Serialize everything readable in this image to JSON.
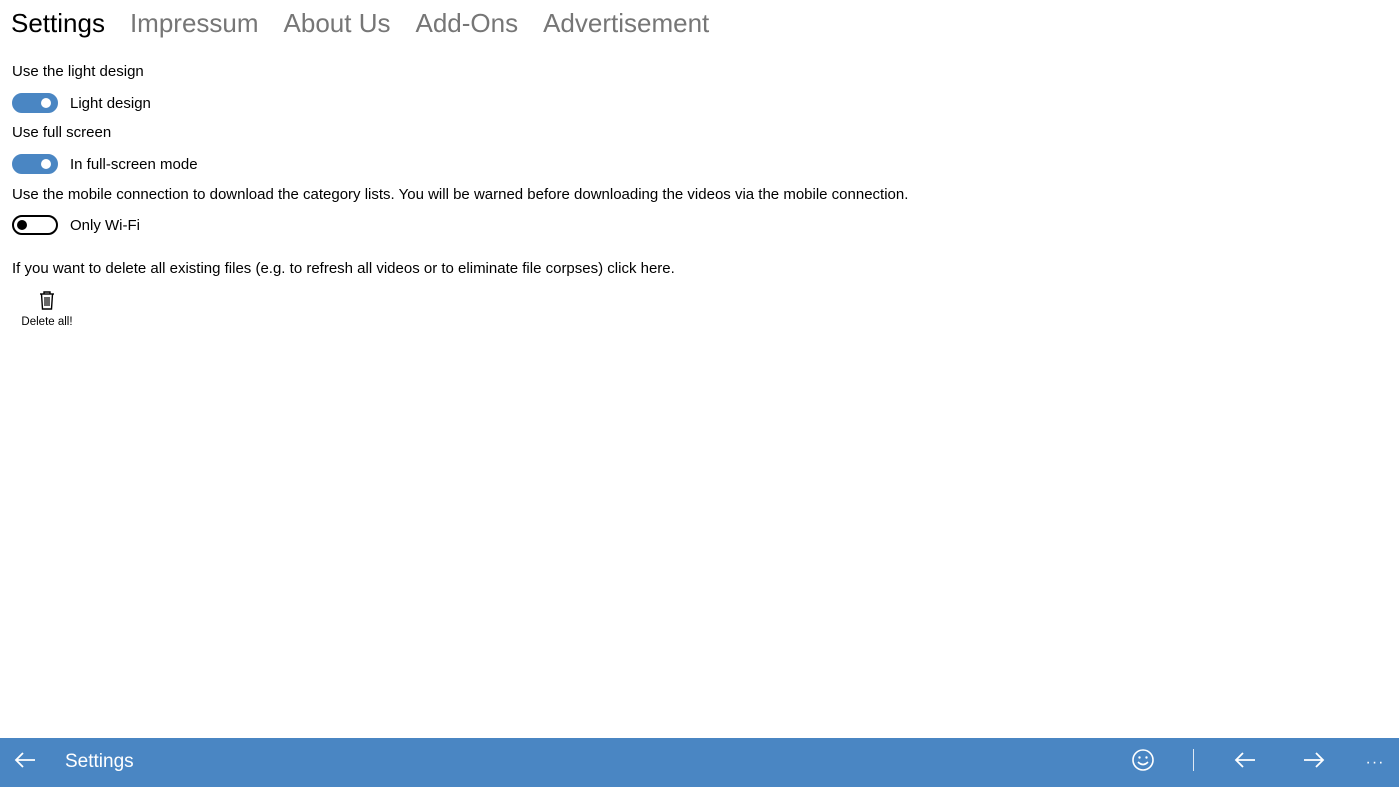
{
  "pivot": {
    "tabs": [
      {
        "label": "Settings",
        "active": true
      },
      {
        "label": "Impressum",
        "active": false
      },
      {
        "label": "About Us",
        "active": false
      },
      {
        "label": "Add-Ons",
        "active": false
      },
      {
        "label": "Advertisement",
        "active": false
      }
    ]
  },
  "settings": {
    "light_design": {
      "description": "Use the light design",
      "toggle_label": "Light design",
      "on": true
    },
    "full_screen": {
      "description": "Use full screen",
      "toggle_label": "In full-screen mode",
      "on": true
    },
    "mobile_connection": {
      "description": "Use the mobile connection to download the category lists. You will be warned before downloading the videos via the mobile connection.",
      "toggle_label": "Only Wi-Fi",
      "on": false
    },
    "delete": {
      "description": "If you want to delete all existing files (e.g. to refresh all videos or to eliminate file corpses) click here.",
      "button_label": "Delete all!",
      "icon": "trash-icon"
    }
  },
  "command_bar": {
    "title": "Settings",
    "back_icon": "back-arrow-icon",
    "smiley_icon": "smiley-icon",
    "prev_icon": "arrow-left-icon",
    "next_icon": "arrow-right-icon",
    "more_label": "···"
  },
  "colors": {
    "accent": "#4a86c3",
    "inactive_tab": "#767676",
    "text": "#000000"
  }
}
